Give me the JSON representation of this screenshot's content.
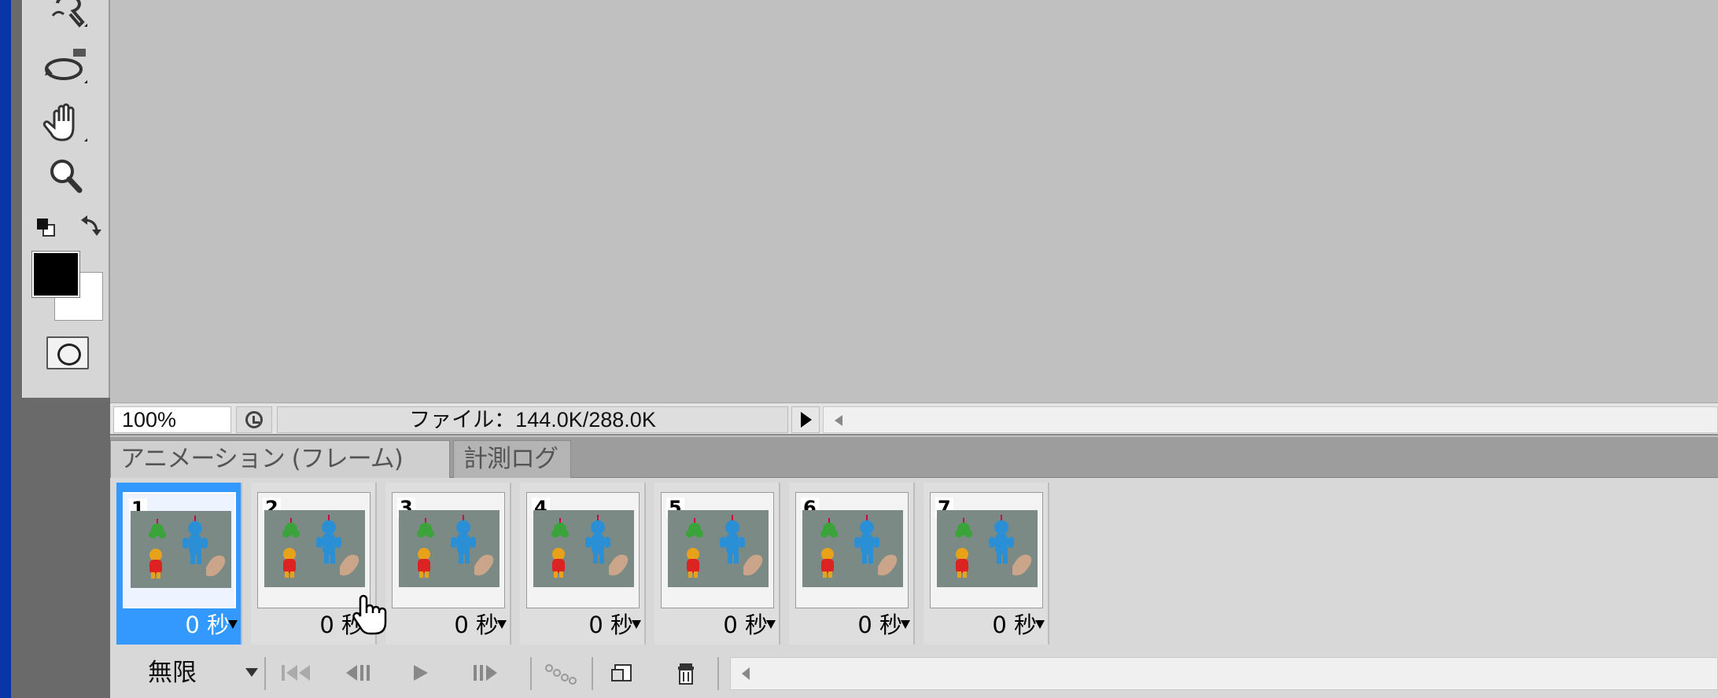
{
  "status_bar": {
    "zoom": "100%",
    "file_info": "ファイル：144.0K/288.0K"
  },
  "panel": {
    "tabs": [
      {
        "label": "アニメーション (フレーム)",
        "active": true
      },
      {
        "label": "計測ログ",
        "active": false
      }
    ],
    "frames": [
      {
        "number": "1",
        "delay": "0 秒",
        "selected": true
      },
      {
        "number": "2",
        "delay": "0 秒",
        "selected": false
      },
      {
        "number": "3",
        "delay": "0 秒",
        "selected": false
      },
      {
        "number": "4",
        "delay": "0 秒",
        "selected": false
      },
      {
        "number": "5",
        "delay": "0 秒",
        "selected": false
      },
      {
        "number": "6",
        "delay": "0 秒",
        "selected": false
      },
      {
        "number": "7",
        "delay": "0 秒",
        "selected": false
      }
    ],
    "loop_option": "無限"
  },
  "toolbar_icons": [
    "first-frame-icon",
    "previous-frame-icon",
    "play-icon",
    "next-frame-icon",
    "tween-icon",
    "new-frame-icon",
    "trash-icon"
  ],
  "tool_icons": [
    "quick-selection-icon",
    "rotate-view-icon",
    "hand-icon",
    "zoom-icon",
    "default-colors-icon",
    "swap-colors-icon",
    "quick-mask-icon"
  ],
  "colors": {
    "selection": "#3399ff",
    "foreground": "#000000",
    "background": "#ffffff",
    "canvas": "#c0c0c0"
  }
}
